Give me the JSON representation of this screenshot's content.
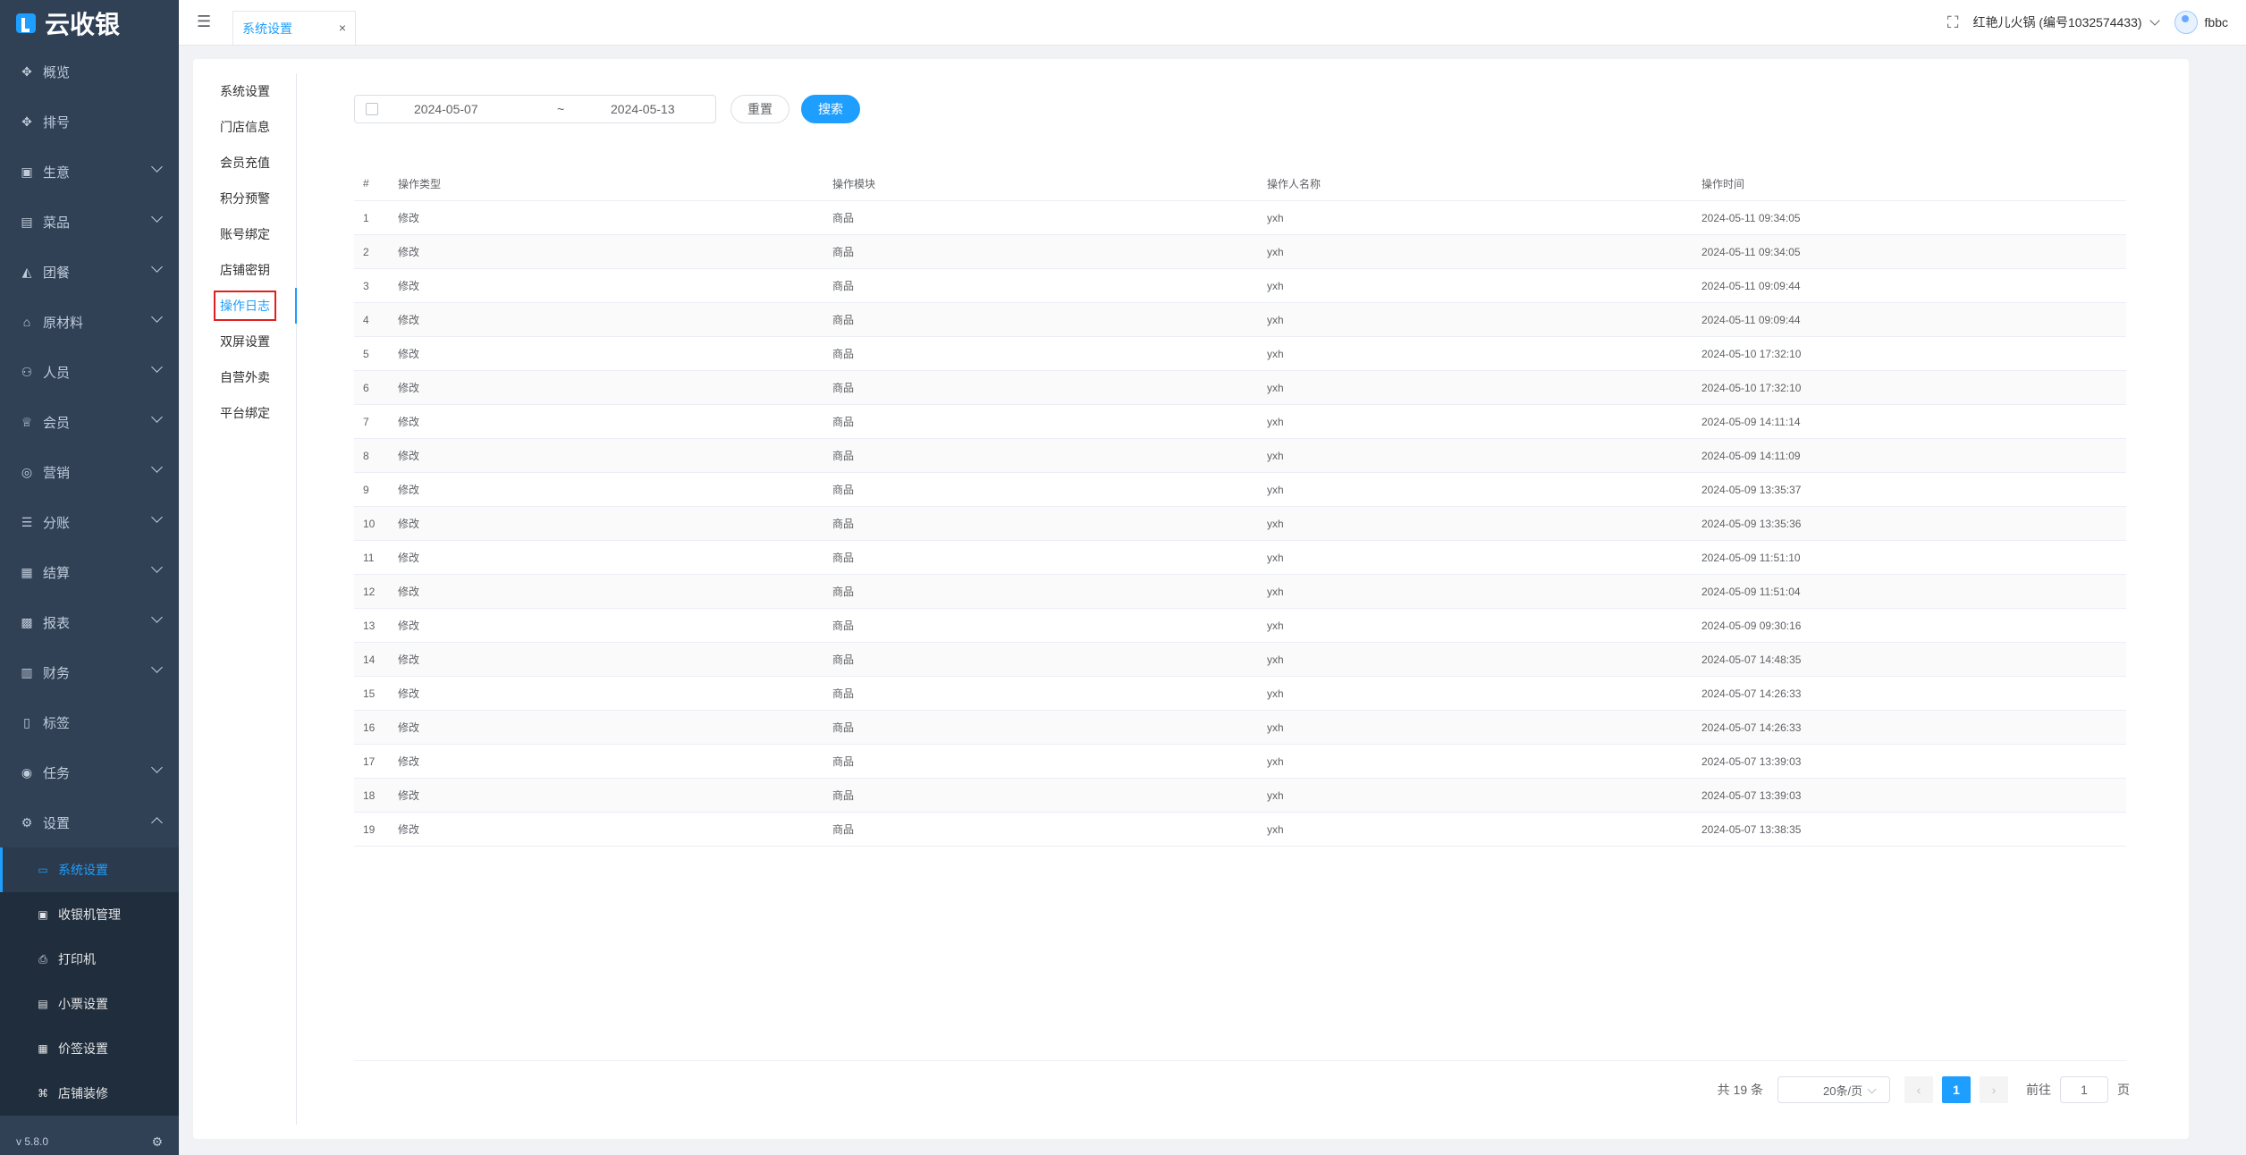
{
  "app": {
    "name": "云收银",
    "version": "v 5.8.0"
  },
  "sidebar": {
    "items": [
      {
        "label": "概览",
        "icon": "overview-icon",
        "glyph": "✥",
        "has_children": false
      },
      {
        "label": "排号",
        "icon": "queue-icon",
        "glyph": "✥",
        "has_children": false
      },
      {
        "label": "生意",
        "icon": "business-icon",
        "glyph": "▣",
        "has_children": true
      },
      {
        "label": "菜品",
        "icon": "dish-icon",
        "glyph": "▤",
        "has_children": true
      },
      {
        "label": "团餐",
        "icon": "group-meal-icon",
        "glyph": "◭",
        "has_children": true
      },
      {
        "label": "原材料",
        "icon": "material-icon",
        "glyph": "⌂",
        "has_children": true
      },
      {
        "label": "人员",
        "icon": "staff-icon",
        "glyph": "⚇",
        "has_children": true
      },
      {
        "label": "会员",
        "icon": "member-icon",
        "glyph": "♕",
        "has_children": true
      },
      {
        "label": "营销",
        "icon": "marketing-icon",
        "glyph": "◎",
        "has_children": true
      },
      {
        "label": "分账",
        "icon": "split-icon",
        "glyph": "☰",
        "has_children": true
      },
      {
        "label": "结算",
        "icon": "settle-icon",
        "glyph": "▦",
        "has_children": true
      },
      {
        "label": "报表",
        "icon": "report-icon",
        "glyph": "▩",
        "has_children": true
      },
      {
        "label": "财务",
        "icon": "finance-icon",
        "glyph": "▥",
        "has_children": true
      },
      {
        "label": "标签",
        "icon": "tag-icon",
        "glyph": "▯",
        "has_children": false
      },
      {
        "label": "任务",
        "icon": "task-icon",
        "glyph": "◉",
        "has_children": true
      },
      {
        "label": "设置",
        "icon": "settings-icon",
        "glyph": "⚙",
        "has_children": true,
        "expanded": true
      }
    ],
    "settings_children": [
      {
        "label": "系统设置",
        "icon": "monitor-icon",
        "glyph": "▭",
        "active": true
      },
      {
        "label": "收银机管理",
        "icon": "cashier-icon",
        "glyph": "▣",
        "active": false
      },
      {
        "label": "打印机",
        "icon": "printer-icon",
        "glyph": "⎙",
        "active": false
      },
      {
        "label": "小票设置",
        "icon": "receipt-icon",
        "glyph": "▤",
        "active": false
      },
      {
        "label": "价签设置",
        "icon": "price-tag-icon",
        "glyph": "▦",
        "active": false
      },
      {
        "label": "店铺装修",
        "icon": "decorate-icon",
        "glyph": "⌘",
        "active": false
      }
    ]
  },
  "topbar": {
    "tab_label": "系统设置",
    "tab_close": "×",
    "menu_glyph": "☰",
    "fullscreen_glyph": "⛶",
    "store": "红艳儿火锅 (编号1032574433)",
    "user": "fbbc"
  },
  "settings_nav": [
    {
      "label": "系统设置",
      "active": false
    },
    {
      "label": "门店信息",
      "active": false
    },
    {
      "label": "会员充值",
      "active": false
    },
    {
      "label": "积分预警",
      "active": false
    },
    {
      "label": "账号绑定",
      "active": false
    },
    {
      "label": "店铺密钥",
      "active": false
    },
    {
      "label": "操作日志",
      "active": true
    },
    {
      "label": "双屏设置",
      "active": false
    },
    {
      "label": "自营外卖",
      "active": false
    },
    {
      "label": "平台绑定",
      "active": false
    }
  ],
  "filter": {
    "start_date": "2024-05-07",
    "separator": "~",
    "end_date": "2024-05-13",
    "reset_label": "重置",
    "search_label": "搜索"
  },
  "table": {
    "headers": [
      "#",
      "操作类型",
      "操作模块",
      "操作人名称",
      "操作时间"
    ],
    "rows": [
      [
        "1",
        "修改",
        "商品",
        "yxh",
        "2024-05-11 09:34:05"
      ],
      [
        "2",
        "修改",
        "商品",
        "yxh",
        "2024-05-11 09:34:05"
      ],
      [
        "3",
        "修改",
        "商品",
        "yxh",
        "2024-05-11 09:09:44"
      ],
      [
        "4",
        "修改",
        "商品",
        "yxh",
        "2024-05-11 09:09:44"
      ],
      [
        "5",
        "修改",
        "商品",
        "yxh",
        "2024-05-10 17:32:10"
      ],
      [
        "6",
        "修改",
        "商品",
        "yxh",
        "2024-05-10 17:32:10"
      ],
      [
        "7",
        "修改",
        "商品",
        "yxh",
        "2024-05-09 14:11:14"
      ],
      [
        "8",
        "修改",
        "商品",
        "yxh",
        "2024-05-09 14:11:09"
      ],
      [
        "9",
        "修改",
        "商品",
        "yxh",
        "2024-05-09 13:35:37"
      ],
      [
        "10",
        "修改",
        "商品",
        "yxh",
        "2024-05-09 13:35:36"
      ],
      [
        "11",
        "修改",
        "商品",
        "yxh",
        "2024-05-09 11:51:10"
      ],
      [
        "12",
        "修改",
        "商品",
        "yxh",
        "2024-05-09 11:51:04"
      ],
      [
        "13",
        "修改",
        "商品",
        "yxh",
        "2024-05-09 09:30:16"
      ],
      [
        "14",
        "修改",
        "商品",
        "yxh",
        "2024-05-07 14:48:35"
      ],
      [
        "15",
        "修改",
        "商品",
        "yxh",
        "2024-05-07 14:26:33"
      ],
      [
        "16",
        "修改",
        "商品",
        "yxh",
        "2024-05-07 14:26:33"
      ],
      [
        "17",
        "修改",
        "商品",
        "yxh",
        "2024-05-07 13:39:03"
      ],
      [
        "18",
        "修改",
        "商品",
        "yxh",
        "2024-05-07 13:39:03"
      ],
      [
        "19",
        "修改",
        "商品",
        "yxh",
        "2024-05-07 13:38:35"
      ]
    ]
  },
  "pagination": {
    "total_text": "共 19 条",
    "page_size": "20条/页",
    "prev": "‹",
    "current_page": "1",
    "next": "›",
    "goto_label": "前往",
    "goto_value": "1",
    "page_suffix": "页"
  },
  "colors": {
    "primary": "#1e9fff",
    "sidebar_bg": "#304156",
    "highlight_border": "#e02020"
  }
}
